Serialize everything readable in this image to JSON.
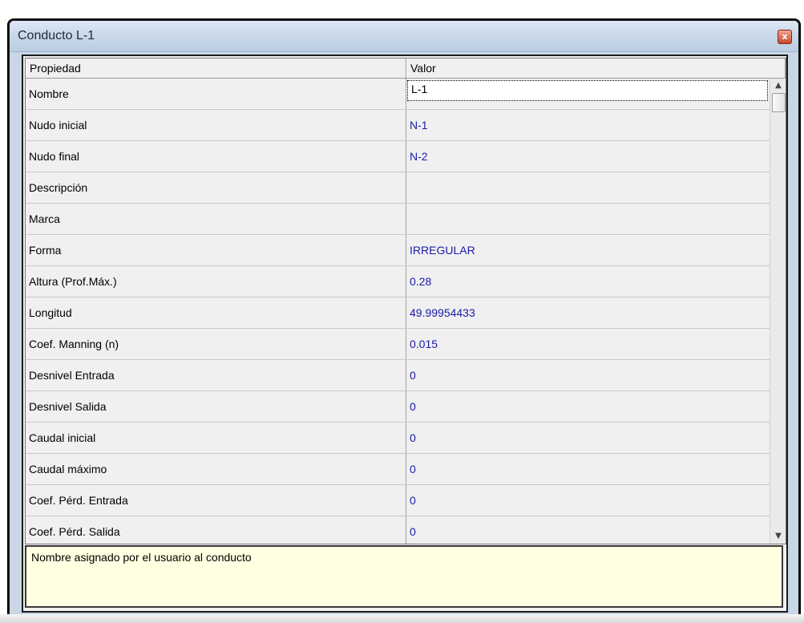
{
  "window": {
    "title": "Conducto L-1",
    "close_label": "x"
  },
  "grid": {
    "headers": {
      "name": "Propiedad",
      "value": "Valor"
    },
    "rows": [
      {
        "name": "Nombre",
        "value": "L-1"
      },
      {
        "name": "Nudo inicial",
        "value": "N-1"
      },
      {
        "name": "Nudo final",
        "value": "N-2"
      },
      {
        "name": "Descripción",
        "value": ""
      },
      {
        "name": "Marca",
        "value": ""
      },
      {
        "name": "Forma",
        "value": "IRREGULAR"
      },
      {
        "name": "Altura (Prof.Máx.)",
        "value": "0.28"
      },
      {
        "name": "Longitud",
        "value": "49.99954433"
      },
      {
        "name": "Coef. Manning (n)",
        "value": "0.015"
      },
      {
        "name": "Desnivel Entrada",
        "value": "0"
      },
      {
        "name": "Desnivel Salida",
        "value": "0"
      },
      {
        "name": "Caudal inicial",
        "value": "0"
      },
      {
        "name": "Caudal máximo",
        "value": "0"
      },
      {
        "name": "Coef. Pérd. Entrada",
        "value": "0"
      },
      {
        "name": "Coef. Pérd. Salida",
        "value": "0"
      }
    ]
  },
  "scrollbar": {
    "up_icon": "▲",
    "down_icon": "▼"
  },
  "description": {
    "text": "Nombre asignado por el usuario al conducto"
  },
  "colors": {
    "value_text": "#1a1aa8",
    "desc_bg": "#ffffe1",
    "title_bg": "#cad9ea"
  }
}
